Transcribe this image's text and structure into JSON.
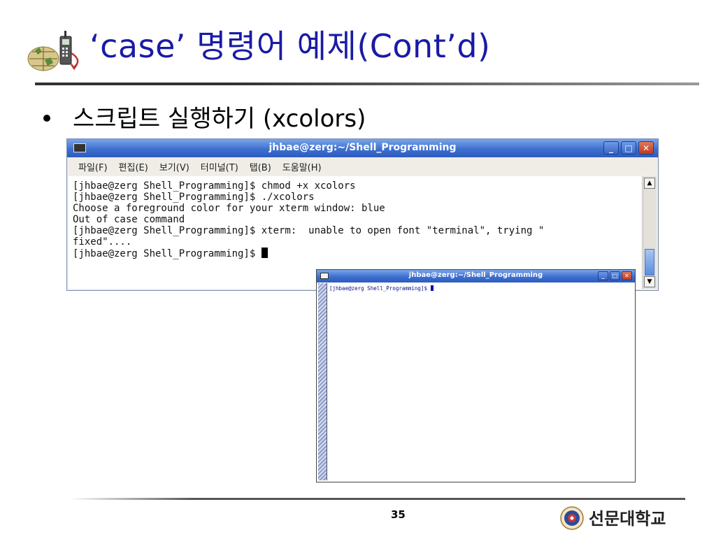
{
  "slide": {
    "title": "‘case’ 명령어 예제(Cont’d)",
    "bullet": "스크립트 실행하기 (xcolors)",
    "page_number": "35",
    "logo_text": "선문대학교"
  },
  "terminal_main": {
    "title": "jhbae@zerg:~/Shell_Programming",
    "menu": [
      "파일(F)",
      "편집(E)",
      "보기(V)",
      "터미널(T)",
      "탭(B)",
      "도움말(H)"
    ],
    "lines": [
      "[jhbae@zerg Shell_Programming]$ chmod +x xcolors",
      "[jhbae@zerg Shell_Programming]$ ./xcolors",
      "Choose a foreground color for your xterm window: blue",
      "Out of case command",
      "[jhbae@zerg Shell_Programming]$ xterm:  unable to open font \"terminal\", trying \"",
      "fixed\"....",
      "[jhbae@zerg Shell_Programming]$ "
    ],
    "buttons": {
      "minimize": "_",
      "maximize": "□",
      "close": "✕"
    },
    "scroll": {
      "up": "▲",
      "down": "▼"
    }
  },
  "terminal_xterm": {
    "title": "jhbae@zerg:~/Shell_Programming",
    "prompt": "[jhbae@zerg Shell_Programming]$ ",
    "text_color": "#0a0a8a",
    "buttons": {
      "minimize": "_",
      "maximize": "□",
      "close": "✕"
    }
  },
  "colors": {
    "title": "#1a1aa6",
    "titlebar": "#3e6fcf"
  }
}
